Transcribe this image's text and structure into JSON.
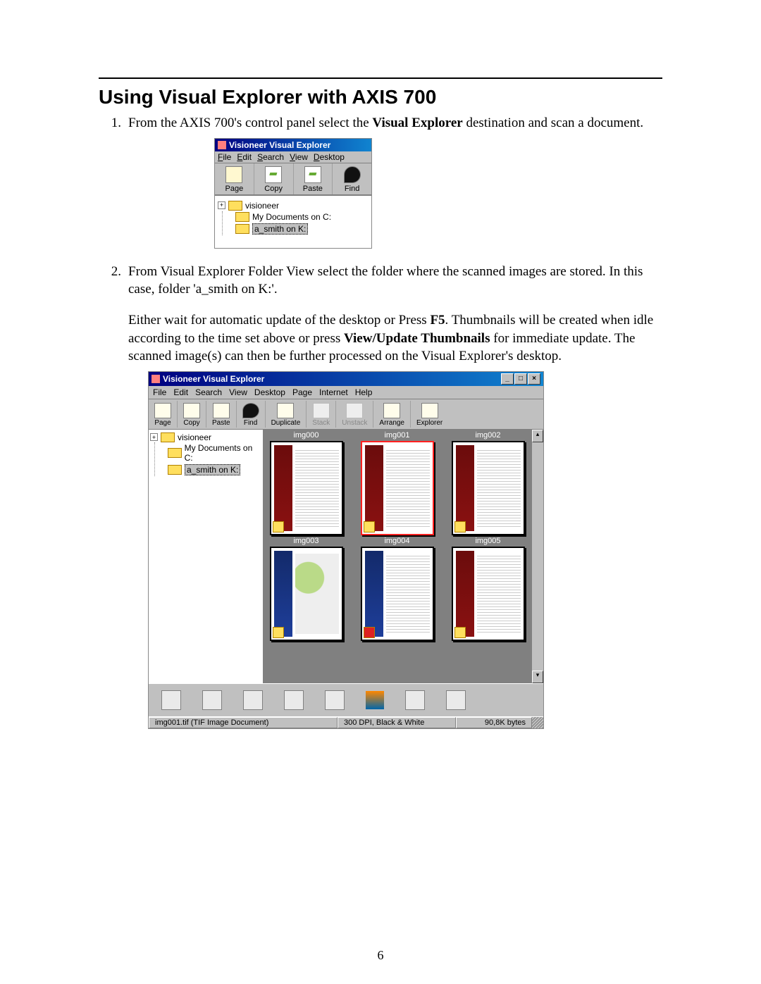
{
  "heading": "Using Visual Explorer with AXIS 700",
  "step1": {
    "num": "1.",
    "text_a": "From the AXIS 700's control panel select the ",
    "bold": "Visual Explorer",
    "text_b": " destination and scan a document."
  },
  "screenshot1": {
    "title": "Visioneer Visual Explorer",
    "menu": {
      "file": "File",
      "edit": "Edit",
      "search": "Search",
      "view": "View",
      "desktop": "Desktop"
    },
    "toolbar": {
      "page": "Page",
      "copy": "Copy",
      "paste": "Paste",
      "find": "Find"
    },
    "tree": {
      "root": "visioneer",
      "item1": "My Documents on C:",
      "item2": "a_smith on K:"
    }
  },
  "step2": {
    "num": "2.",
    "text": "From Visual Explorer Folder View select the folder where the scanned images are stored. In this case, folder 'a_smith on K:'."
  },
  "para2": {
    "a": "Either wait for automatic update of the desktop or Press ",
    "b1": "F5",
    "c": ". Thumbnails will be created when idle according to the time set above or press ",
    "b2": "View/Update Thumbnails",
    "d": " for immediate update. The scanned image(s) can then be further processed on the Visual Explorer's desktop."
  },
  "screenshot2": {
    "title": "Visioneer Visual Explorer",
    "menu": {
      "file": "File",
      "edit": "Edit",
      "search": "Search",
      "view": "View",
      "desktop": "Desktop",
      "page": "Page",
      "internet": "Internet",
      "help": "Help"
    },
    "toolbar": {
      "page": "Page",
      "copy": "Copy",
      "paste": "Paste",
      "find": "Find",
      "duplicate": "Duplicate",
      "stack": "Stack",
      "unstack": "Unstack",
      "arrange": "Arrange",
      "explorer": "Explorer"
    },
    "tree": {
      "root": "visioneer",
      "item1": "My Documents on C:",
      "item2": "a_smith on K:"
    },
    "thumbs": [
      "img000",
      "img001",
      "img002",
      "img003",
      "img004",
      "img005"
    ],
    "status": {
      "file": "img001.tif (TIF Image Document)",
      "mode": "300 DPI, Black & White",
      "size": "90,8K bytes"
    }
  },
  "pagenum": "6"
}
